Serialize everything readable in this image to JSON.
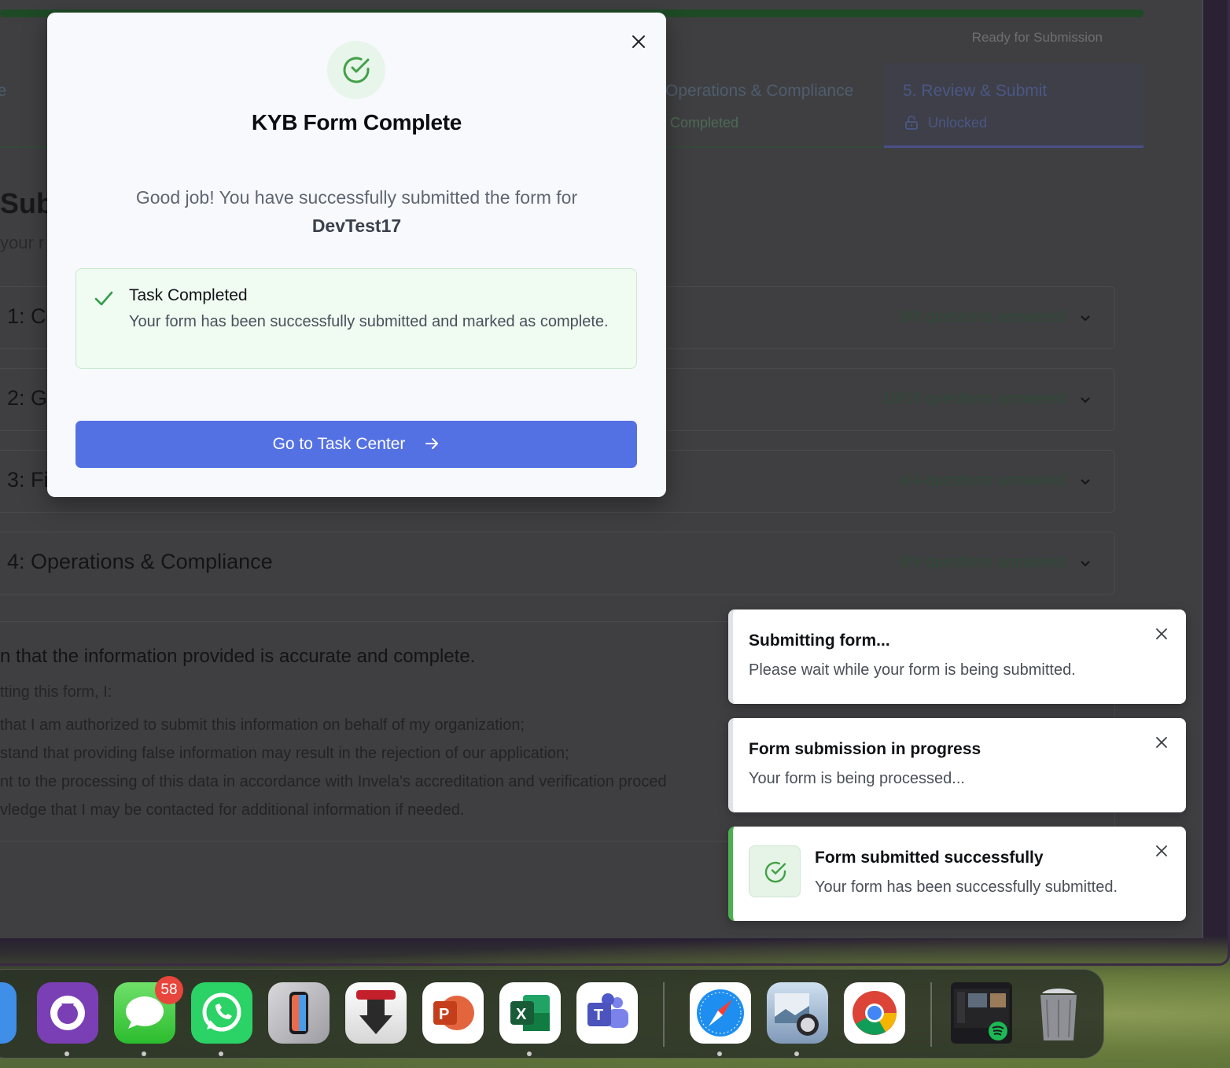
{
  "window": {
    "ready_label": "Ready for Submission",
    "progress_percent": 100
  },
  "steps": [
    {
      "title": "le",
      "sub": ""
    },
    {
      "title": "Operations & Compliance",
      "sub": "Completed"
    },
    {
      "title": "5. Review & Submit",
      "sub": "Unlocked"
    }
  ],
  "page": {
    "heading_fragment": "Sub",
    "sub_fragment": "your r"
  },
  "sections": [
    {
      "title": "1: Co",
      "count": "8/8 questions answered"
    },
    {
      "title": "2: G",
      "count": "10/10 questions answered"
    },
    {
      "title": "3: Fi",
      "count": "4/4 questions answered"
    },
    {
      "title": "4: Operations & Compliance",
      "count": "8/8 questions answered"
    }
  ],
  "declaration": {
    "title": "n that the information provided is accurate and complete.",
    "lead": "tting this form, I:",
    "lines": [
      " that I am authorized to submit this information on behalf of my organization;",
      "stand that providing false information may result in the rejection of our application;",
      "nt to the processing of this data in accordance with Invela's accreditation and verification proced",
      "vledge that I may be contacted for additional information if needed."
    ]
  },
  "modal": {
    "title": "KYB Form Complete",
    "message": "Good job! You have successfully submitted the form for",
    "company": "DevTest17",
    "task_title": "Task Completed",
    "task_desc": "Your form has been successfully submitted and marked as complete.",
    "button_label": "Go to Task Center"
  },
  "toasts": [
    {
      "title": "Submitting form...",
      "desc": "Please wait while your form is being submitted."
    },
    {
      "title": "Form submission in progress",
      "desc": "Your form is being processed..."
    },
    {
      "title": "Form submitted successfully",
      "desc": "Your form has been successfully submitted."
    }
  ],
  "dock": {
    "messages_badge": "58",
    "apps": [
      "finder-icon",
      "github-desktop-icon",
      "messages-icon",
      "whatsapp-icon",
      "iphone-mirroring-icon",
      "transmit-icon",
      "powerpoint-icon",
      "excel-icon",
      "teams-icon",
      "safari-icon",
      "preview-icon",
      "chrome-icon",
      "spotify-window-icon",
      "trash-icon"
    ]
  },
  "colors": {
    "accent": "#5471e3",
    "success": "#4caf50"
  }
}
